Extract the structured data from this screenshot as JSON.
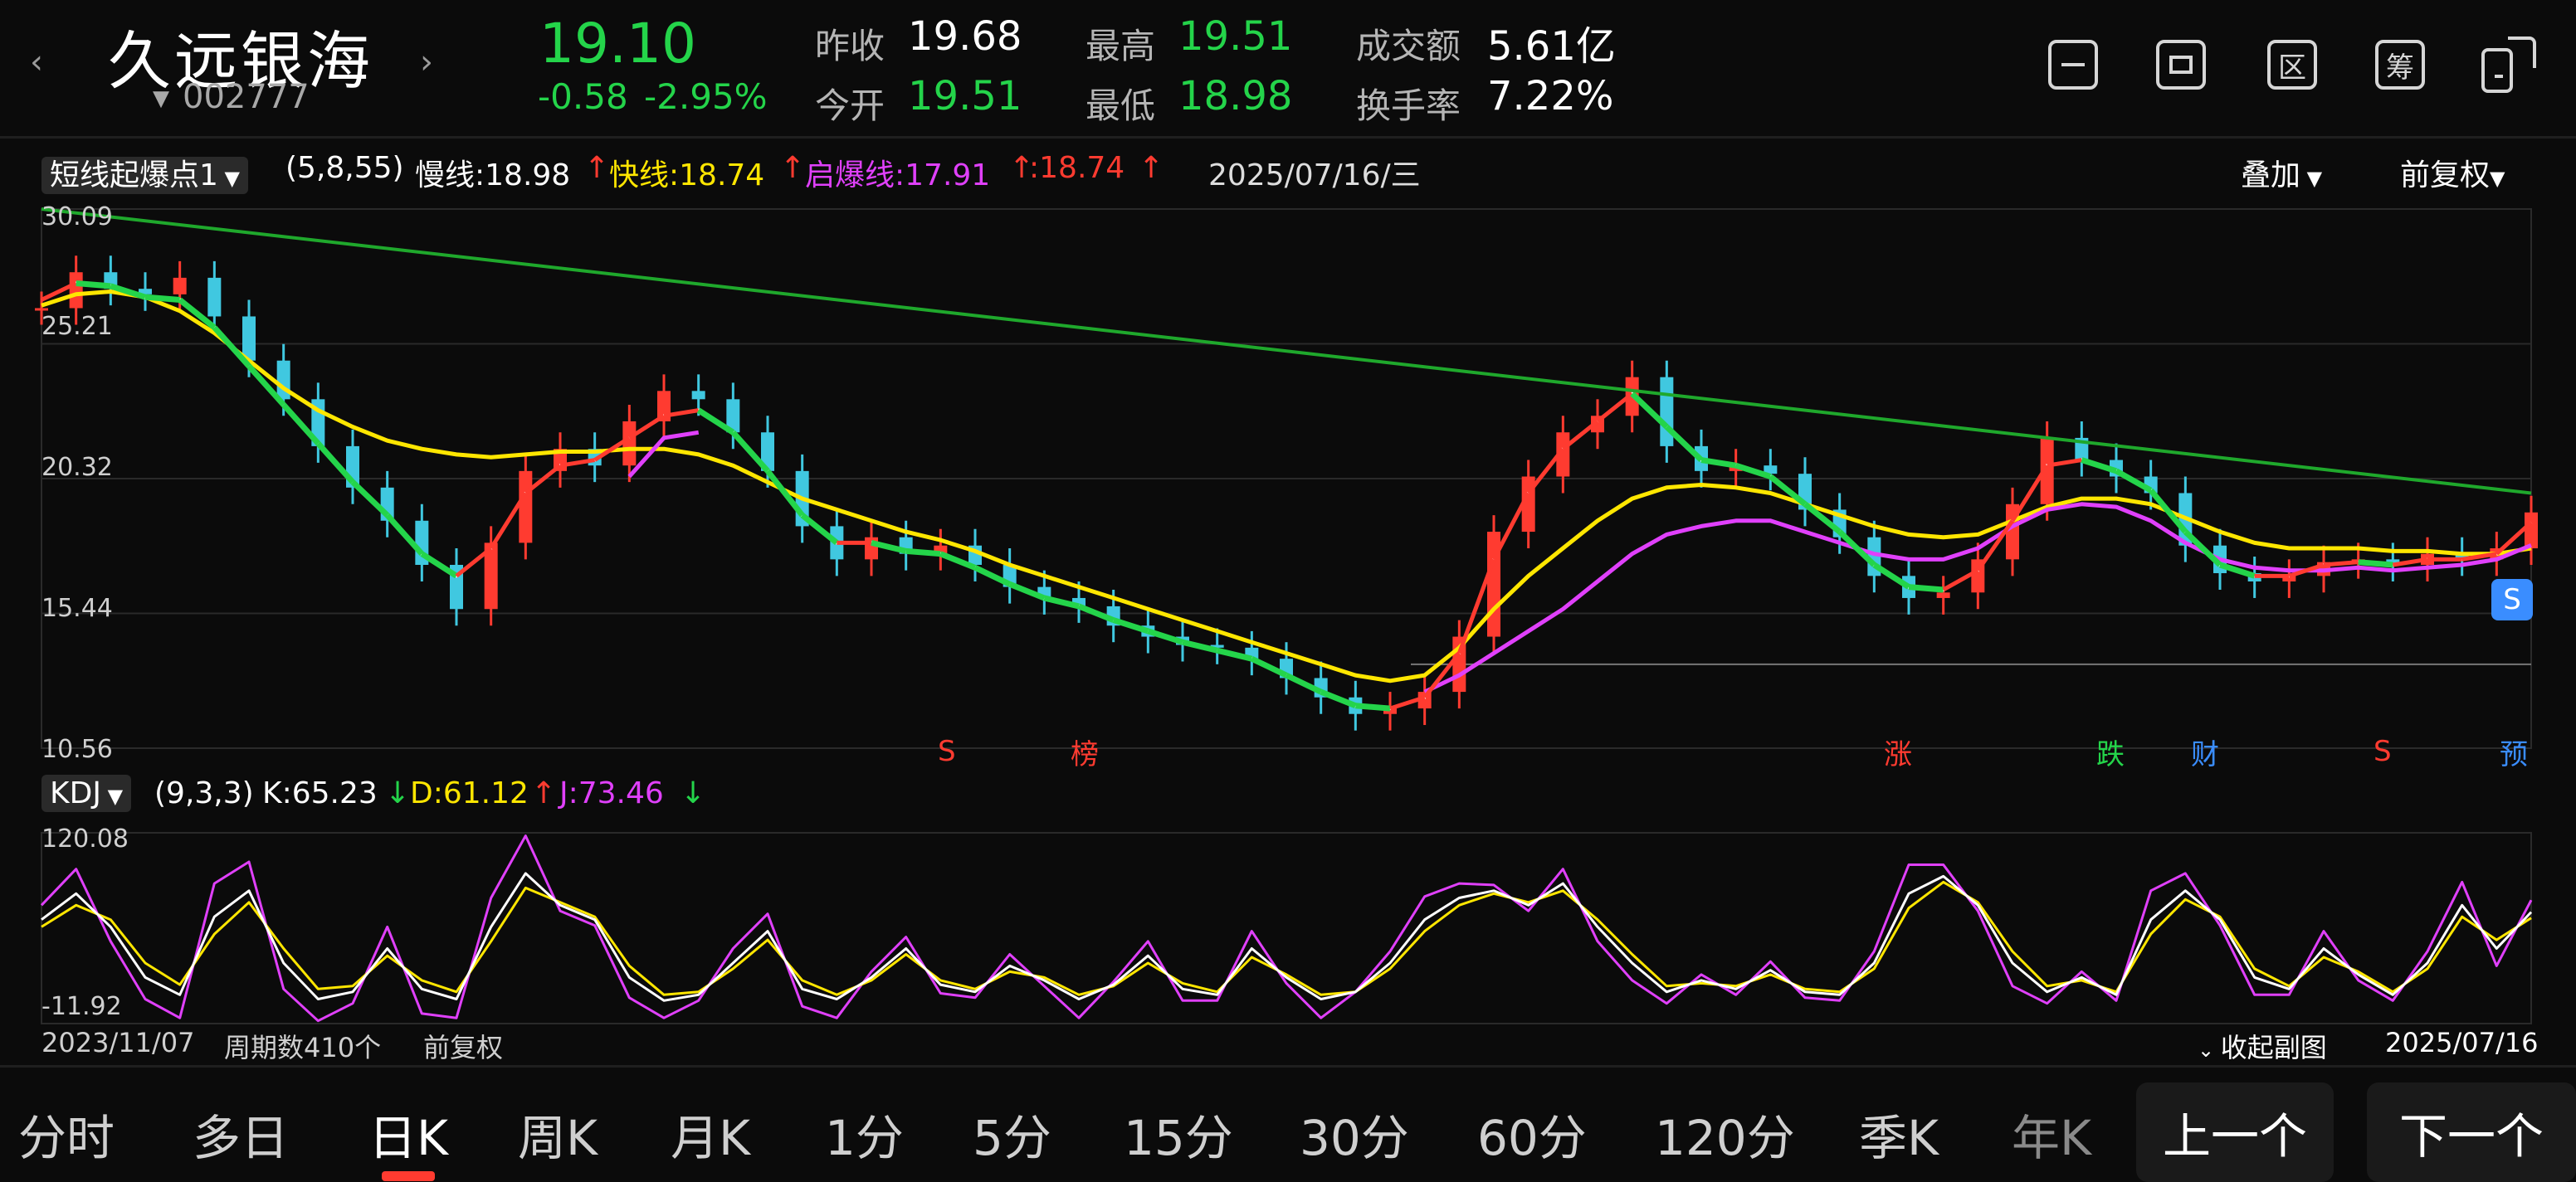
{
  "header": {
    "stock_name": "久远银海",
    "stock_code": "002777",
    "price": "19.10",
    "change": "-0.58",
    "change_pct": "-2.95%",
    "prev_close_label": "昨收",
    "prev_close": "19.68",
    "open_label": "今开",
    "open": "19.51",
    "high_label": "最高",
    "high": "19.51",
    "low_label": "最低",
    "low": "18.98",
    "turnover_amount_label": "成交额",
    "turnover_amount": "5.61亿",
    "turnover_rate_label": "换手率",
    "turnover_rate": "7.22%"
  },
  "toolbar": {
    "icons": [
      "minus-box-icon",
      "screen-box-icon",
      "区",
      "筹",
      "rotate-device-icon"
    ],
    "qu": "区",
    "chou": "筹"
  },
  "indicator_main": {
    "name": "短线起爆点1",
    "params": "(5,8,55)",
    "slow": "慢线:18.98",
    "fast": "快线:18.74",
    "start": "启爆线:17.91",
    "start2": ":18.74",
    "date": "2025/07/16/三",
    "overlay": "叠加",
    "adjust": "前复权"
  },
  "main_axis": {
    "labels": [
      "30.09",
      "25.21",
      "20.32",
      "15.44",
      "10.56"
    ]
  },
  "markers": {
    "s1": "S",
    "bang": "榜",
    "zhang": "涨",
    "die": "跌",
    "cai": "财",
    "s2": "S",
    "yu": "预",
    "badge": "S"
  },
  "indicator_sub": {
    "name": "KDJ",
    "params": "(9,3,3)",
    "k": "K:65.23",
    "d": "D:61.12",
    "j": "J:73.46",
    "top": "120.08",
    "bottom": "-11.92"
  },
  "footer": {
    "start_date": "2023/11/07",
    "periods": "周期数410个",
    "adjust": "前复权",
    "collapse": "收起副图",
    "end_date": "2025/07/16"
  },
  "tabs": [
    "分时",
    "多日",
    "日K",
    "周K",
    "月K",
    "1分",
    "5分",
    "15分",
    "30分",
    "60分",
    "120分",
    "季K",
    "年K"
  ],
  "buttons": {
    "prev": "上一个",
    "next": "下一个"
  },
  "colors": {
    "up": "#ff3b30",
    "down": "#24d44a",
    "fast_line": "#ffe600",
    "start_line": "#e040fb",
    "trend_line": "#1fa82c"
  },
  "chart_data": {
    "type": "line",
    "main": {
      "ylim": [
        10.56,
        30.09
      ],
      "close": [
        26.5,
        27.8,
        27.2,
        27.0,
        27.6,
        26.2,
        24.6,
        23.2,
        21.5,
        20.0,
        18.8,
        17.2,
        15.6,
        18.0,
        20.6,
        21.4,
        20.8,
        22.4,
        23.5,
        23.2,
        22.0,
        20.6,
        18.6,
        17.4,
        18.2,
        17.6,
        17.9,
        17.2,
        16.4,
        16.0,
        15.7,
        15.0,
        14.6,
        14.3,
        14.2,
        13.8,
        13.1,
        12.4,
        11.8,
        12.0,
        12.6,
        14.6,
        18.4,
        20.4,
        22.0,
        22.6,
        24.0,
        21.5,
        20.6,
        20.8,
        20.5,
        19.2,
        18.2,
        16.8,
        16.0,
        16.2,
        17.4,
        19.4,
        21.8,
        21.0,
        20.4,
        19.8,
        17.9,
        16.9,
        16.6,
        16.8,
        17.3,
        17.4,
        17.2,
        17.6,
        17.4,
        17.8,
        19.1
      ],
      "ma_fast": [
        26.8,
        27.4,
        27.3,
        26.9,
        26.8,
        25.8,
        24.4,
        23.0,
        21.6,
        20.2,
        19.0,
        17.6,
        16.8,
        17.8,
        19.8,
        20.8,
        21.0,
        21.8,
        22.6,
        22.8,
        22.0,
        20.6,
        19.0,
        18.0,
        18.0,
        17.7,
        17.6,
        17.1,
        16.5,
        16.0,
        15.7,
        15.2,
        14.8,
        14.4,
        14.1,
        13.8,
        13.2,
        12.6,
        12.1,
        12.0,
        12.4,
        14.0,
        17.4,
        19.8,
        21.4,
        22.4,
        23.4,
        22.2,
        21.0,
        20.8,
        20.4,
        19.4,
        18.4,
        17.2,
        16.4,
        16.3,
        17.0,
        18.8,
        20.8,
        21.0,
        20.6,
        19.9,
        18.4,
        17.2,
        16.8,
        16.8,
        17.2,
        17.3,
        17.2,
        17.4,
        17.4,
        17.6,
        18.74
      ],
      "start_line": [
        null,
        null,
        null,
        null,
        null,
        null,
        null,
        null,
        null,
        null,
        null,
        null,
        null,
        null,
        null,
        null,
        null,
        20.4,
        21.8,
        22.0,
        null,
        null,
        null,
        null,
        null,
        null,
        null,
        null,
        null,
        null,
        null,
        null,
        null,
        null,
        null,
        null,
        null,
        null,
        null,
        null,
        12.6,
        13.2,
        14.0,
        14.8,
        15.6,
        16.6,
        17.6,
        18.3,
        18.6,
        18.8,
        18.8,
        18.4,
        18.0,
        17.6,
        17.4,
        17.4,
        17.8,
        18.6,
        19.2,
        19.4,
        19.3,
        18.8,
        18.0,
        17.4,
        17.1,
        17.0,
        17.0,
        17.1,
        17.0,
        17.1,
        17.2,
        17.4,
        17.91
      ],
      "slow_line": [
        26.6,
        27.0,
        27.1,
        26.9,
        26.4,
        25.6,
        24.6,
        23.6,
        22.8,
        22.2,
        21.7,
        21.4,
        21.2,
        21.1,
        21.2,
        21.3,
        21.3,
        21.4,
        21.4,
        21.2,
        20.8,
        20.2,
        19.6,
        19.2,
        18.8,
        18.4,
        18.1,
        17.7,
        17.2,
        16.8,
        16.4,
        16.0,
        15.6,
        15.2,
        14.8,
        14.4,
        14.0,
        13.6,
        13.2,
        13.0,
        13.2,
        14.2,
        15.6,
        16.8,
        17.8,
        18.8,
        19.6,
        20.0,
        20.1,
        20.0,
        19.8,
        19.4,
        19.0,
        18.6,
        18.3,
        18.2,
        18.3,
        18.8,
        19.3,
        19.6,
        19.6,
        19.4,
        18.9,
        18.4,
        18.0,
        17.8,
        17.8,
        17.8,
        17.7,
        17.7,
        17.6,
        17.6,
        17.8
      ],
      "trendline": [
        [
          0,
          30.09
        ],
        [
          72,
          19.8
        ]
      ],
      "support": 13.6
    },
    "kdj": {
      "ylim": [
        -11.92,
        120.08
      ],
      "k": [
        60,
        78,
        55,
        20,
        8,
        62,
        80,
        30,
        5,
        10,
        40,
        12,
        5,
        55,
        92,
        70,
        60,
        20,
        4,
        8,
        30,
        52,
        12,
        5,
        20,
        40,
        15,
        10,
        28,
        18,
        5,
        15,
        35,
        12,
        8,
        40,
        20,
        5,
        10,
        30,
        60,
        75,
        80,
        70,
        85,
        55,
        30,
        10,
        18,
        12,
        25,
        10,
        8,
        30,
        78,
        90,
        70,
        30,
        10,
        20,
        8,
        60,
        80,
        60,
        20,
        12,
        40,
        22,
        8,
        30,
        70,
        40,
        65.23
      ],
      "d": [
        55,
        70,
        60,
        30,
        15,
        50,
        72,
        40,
        12,
        14,
        35,
        18,
        10,
        45,
        82,
        72,
        62,
        28,
        8,
        10,
        26,
        46,
        18,
        8,
        18,
        36,
        18,
        12,
        24,
        20,
        8,
        14,
        30,
        16,
        10,
        34,
        22,
        8,
        10,
        26,
        52,
        70,
        78,
        72,
        80,
        60,
        36,
        14,
        16,
        14,
        22,
        12,
        10,
        26,
        68,
        86,
        72,
        38,
        14,
        18,
        10,
        50,
        74,
        62,
        26,
        14,
        34,
        24,
        10,
        26,
        62,
        46,
        61.12
      ],
      "j": [
        70,
        95,
        45,
        5,
        -8,
        85,
        100,
        12,
        -10,
        2,
        55,
        -5,
        -8,
        75,
        118,
        66,
        56,
        6,
        -8,
        4,
        40,
        64,
        0,
        -8,
        24,
        48,
        9,
        6,
        36,
        14,
        -8,
        17,
        45,
        4,
        4,
        52,
        16,
        -8,
        10,
        38,
        76,
        85,
        84,
        66,
        95,
        45,
        18,
        2,
        22,
        8,
        31,
        6,
        4,
        38,
        98,
        98,
        66,
        14,
        2,
        24,
        4,
        80,
        92,
        56,
        8,
        8,
        52,
        18,
        4,
        38,
        86,
        28,
        73.46
      ]
    }
  }
}
